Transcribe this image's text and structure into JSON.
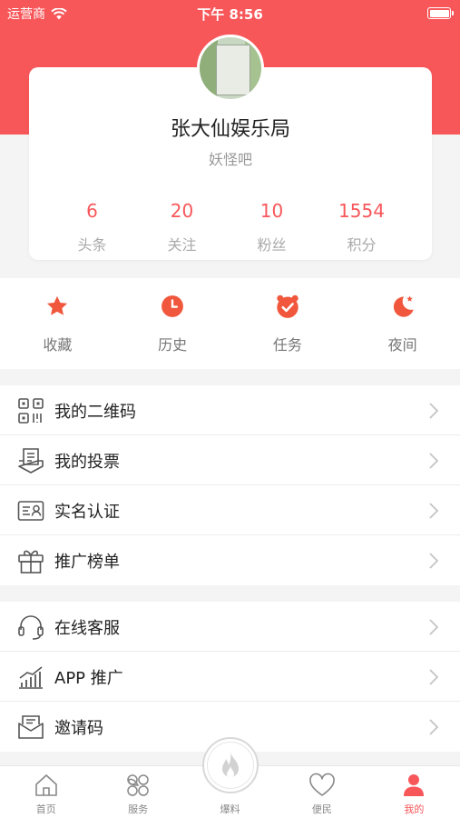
{
  "status": {
    "carrier": "运营商",
    "time": "下午 8:56"
  },
  "profile": {
    "name": "张大仙娱乐局",
    "subtitle": "妖怪吧",
    "stats": [
      {
        "value": "6",
        "label": "头条"
      },
      {
        "value": "20",
        "label": "关注"
      },
      {
        "value": "10",
        "label": "粉丝"
      },
      {
        "value": "1554",
        "label": "积分"
      }
    ]
  },
  "quick_actions": [
    {
      "label": "收藏",
      "icon": "star-icon"
    },
    {
      "label": "历史",
      "icon": "clock-icon"
    },
    {
      "label": "任务",
      "icon": "alarm-icon"
    },
    {
      "label": "夜间",
      "icon": "moon-icon"
    }
  ],
  "menu_group_1": [
    {
      "label": "我的二维码",
      "icon": "qrcode-icon"
    },
    {
      "label": "我的投票",
      "icon": "vote-icon"
    },
    {
      "label": "实名认证",
      "icon": "id-card-icon"
    },
    {
      "label": "推广榜单",
      "icon": "gift-icon"
    }
  ],
  "menu_group_2": [
    {
      "label": "在线客服",
      "icon": "headset-icon"
    },
    {
      "label": "APP 推广",
      "icon": "chart-icon"
    },
    {
      "label": "邀请码",
      "icon": "mail-icon"
    }
  ],
  "tabbar": [
    {
      "label": "首页",
      "icon": "home-icon"
    },
    {
      "label": "服务",
      "icon": "clover-icon"
    },
    {
      "label": "爆料",
      "icon": "flame-icon"
    },
    {
      "label": "便民",
      "icon": "heart-icon"
    },
    {
      "label": "我的",
      "icon": "user-icon",
      "active": true
    }
  ],
  "colors": {
    "accent": "#f8575a",
    "header_bg": "#f8575a"
  }
}
